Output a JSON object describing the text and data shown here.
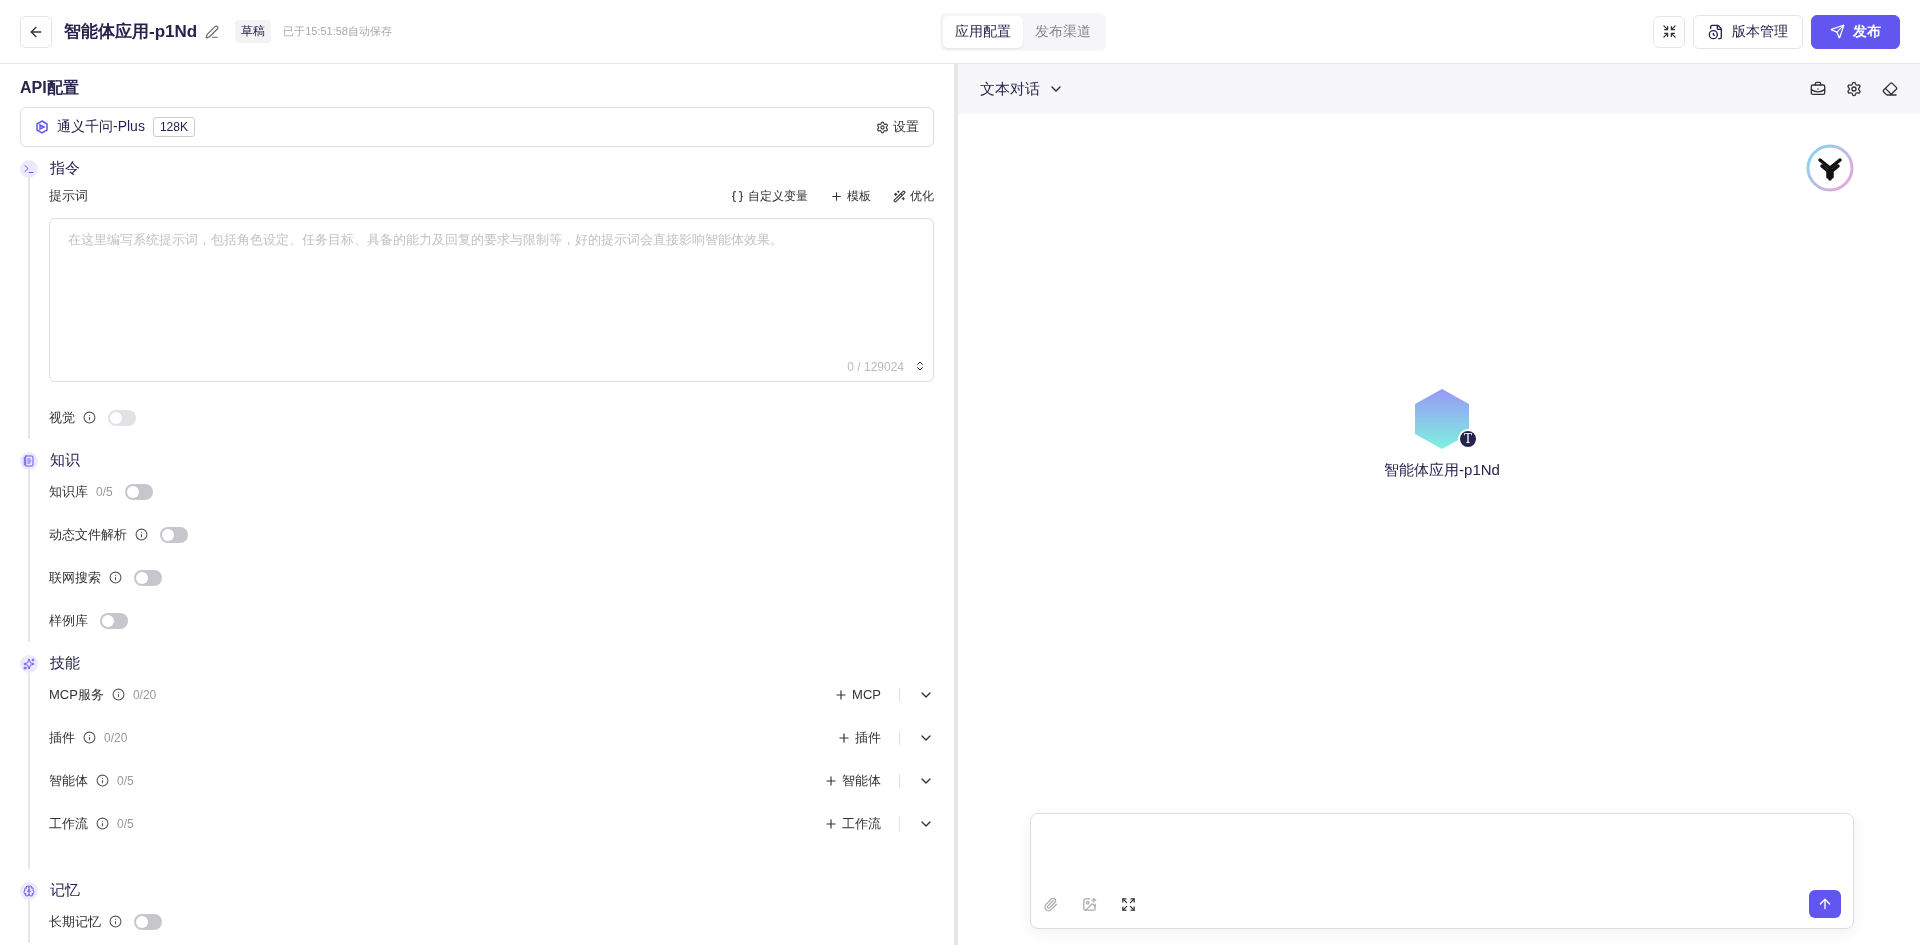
{
  "header": {
    "title": "智能体应用-p1Nd",
    "status": "草稿",
    "saved_note": "已于15:51:58自动保存",
    "tabs": [
      {
        "label": "应用配置",
        "selected": true
      },
      {
        "label": "发布渠道",
        "selected": false
      }
    ],
    "version_button": "版本管理",
    "publish_button": "发布"
  },
  "config": {
    "heading": "API配置",
    "model": {
      "name": "通义千问-Plus",
      "context": "128K",
      "settings": "设置"
    },
    "sections": [
      {
        "kind": "instruction",
        "title": "指令",
        "prompt_label": "提示词",
        "actions": [
          "自定义变量",
          "模板",
          "优化"
        ],
        "placeholder": "在这里编写系统提示词，包括角色设定、任务目标、具备的能力及回复的要求与限制等，好的提示词会直接影响智能体效果。",
        "counter": "0 / 129024",
        "items": [
          {
            "kind": "toggle",
            "label": "视觉",
            "info": true,
            "on": false,
            "disabled": true
          }
        ]
      },
      {
        "kind": "knowledge",
        "title": "知识",
        "items": [
          {
            "kind": "toggle",
            "label": "知识库",
            "count": "0/5",
            "info": false,
            "on": false,
            "disabled": false
          },
          {
            "kind": "toggle",
            "label": "动态文件解析",
            "info": true,
            "on": false,
            "disabled": false
          },
          {
            "kind": "toggle",
            "label": "联网搜索",
            "info": true,
            "on": false,
            "disabled": false
          },
          {
            "kind": "toggle",
            "label": "样例库",
            "info": false,
            "on": false,
            "disabled": false
          }
        ]
      },
      {
        "kind": "skills",
        "title": "技能",
        "items": [
          {
            "kind": "addable",
            "label": "MCP服务",
            "info": true,
            "count": "0/20",
            "add_label": "MCP",
            "expanded": false
          },
          {
            "kind": "addable",
            "label": "插件",
            "info": true,
            "count": "0/20",
            "add_label": "插件",
            "expanded": false
          },
          {
            "kind": "addable",
            "label": "智能体",
            "info": true,
            "count": "0/5",
            "add_label": "智能体",
            "expanded": false
          },
          {
            "kind": "addable",
            "label": "工作流",
            "info": true,
            "count": "0/5",
            "add_label": "工作流",
            "expanded": false
          }
        ]
      },
      {
        "kind": "memory",
        "title": "记忆",
        "items": [
          {
            "kind": "toggle",
            "label": "长期记忆",
            "info": true,
            "on": false,
            "disabled": false
          }
        ]
      }
    ]
  },
  "preview": {
    "mode": "文本对话",
    "agent_name": "智能体应用-p1Nd",
    "avatar_badge": "T"
  }
}
